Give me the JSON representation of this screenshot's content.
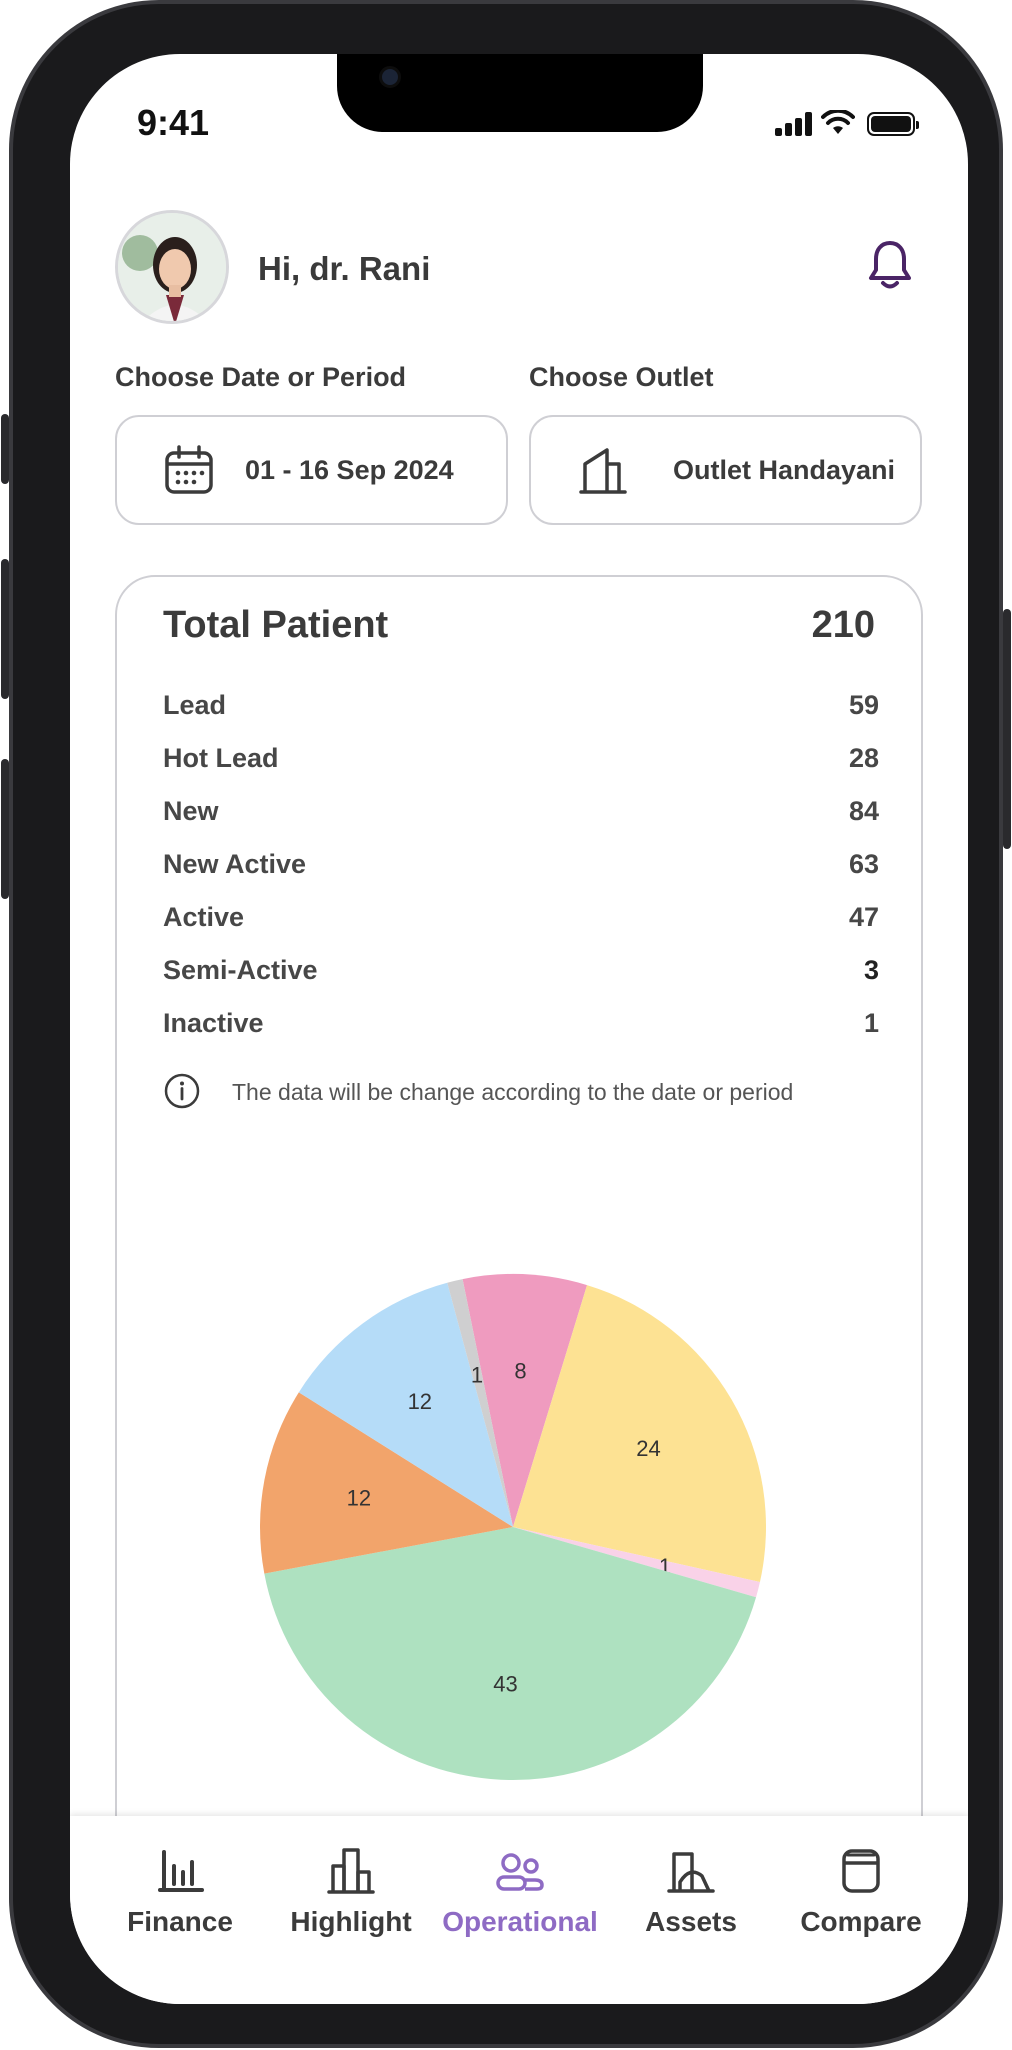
{
  "status": {
    "time": "9:41"
  },
  "header": {
    "greeting": "Hi, dr. Rani"
  },
  "filters": {
    "date_label": "Choose Date or Period",
    "date_value": "01 - 16 Sep 2024",
    "outlet_label": "Choose Outlet",
    "outlet_value": "Outlet Handayani"
  },
  "summary": {
    "title": "Total Patient",
    "total": "210",
    "rows": [
      {
        "label": "Lead",
        "value": "59"
      },
      {
        "label": "Hot Lead",
        "value": "28"
      },
      {
        "label": "New",
        "value": "84"
      },
      {
        "label": "New Active",
        "value": "63"
      },
      {
        "label": "Active",
        "value": "47"
      },
      {
        "label": "Semi-Active",
        "value": "3"
      },
      {
        "label": "Inactive",
        "value": "1"
      }
    ],
    "note": "The data will be change according to the date or period"
  },
  "chart_data": {
    "type": "pie",
    "slices": [
      {
        "value": 8,
        "color": "#ef9bbf"
      },
      {
        "value": 24,
        "color": "#fde293"
      },
      {
        "value": 1,
        "color": "#f9d2e8"
      },
      {
        "value": 43,
        "color": "#aee1c0"
      },
      {
        "value": 12,
        "color": "#f2a46b"
      },
      {
        "value": 12,
        "color": "#b5dcf8"
      },
      {
        "value": 1,
        "color": "#cfcfd0"
      }
    ]
  },
  "nav": {
    "items": [
      {
        "label": "Finance",
        "icon": "bar-chart-icon"
      },
      {
        "label": "Highlight",
        "icon": "buildings-icon"
      },
      {
        "label": "Operational",
        "icon": "users-icon"
      },
      {
        "label": "Assets",
        "icon": "asset-icon"
      },
      {
        "label": "Compare",
        "icon": "compare-icon"
      }
    ],
    "active": "Operational",
    "active_color": "#8e6bc4"
  }
}
